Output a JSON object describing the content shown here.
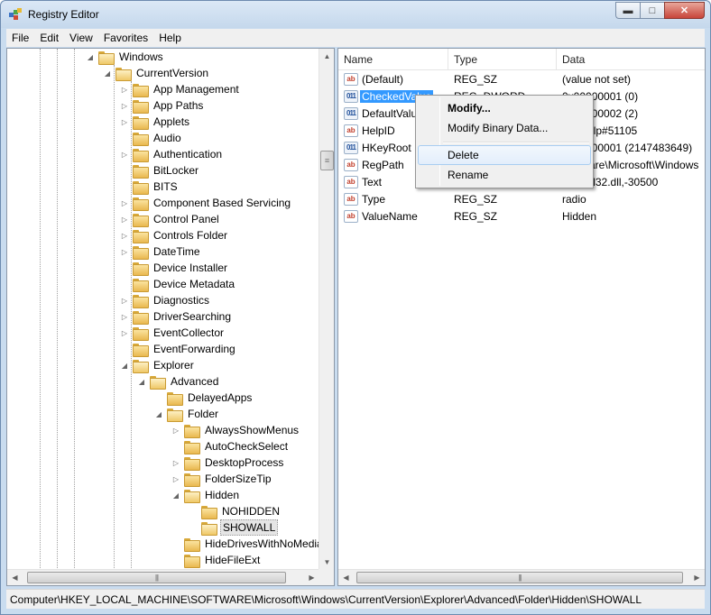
{
  "window": {
    "title": "Registry Editor"
  },
  "menu": [
    "File",
    "Edit",
    "View",
    "Favorites",
    "Help"
  ],
  "tree": [
    {
      "label": "Windows",
      "depth": 0,
      "expander": "open"
    },
    {
      "label": "CurrentVersion",
      "depth": 1,
      "expander": "open"
    },
    {
      "label": "App Management",
      "depth": 2,
      "expander": "closed"
    },
    {
      "label": "App Paths",
      "depth": 2,
      "expander": "closed"
    },
    {
      "label": "Applets",
      "depth": 2,
      "expander": "closed"
    },
    {
      "label": "Audio",
      "depth": 2,
      "expander": "none"
    },
    {
      "label": "Authentication",
      "depth": 2,
      "expander": "closed"
    },
    {
      "label": "BitLocker",
      "depth": 2,
      "expander": "none"
    },
    {
      "label": "BITS",
      "depth": 2,
      "expander": "none"
    },
    {
      "label": "Component Based Servicing",
      "depth": 2,
      "expander": "closed"
    },
    {
      "label": "Control Panel",
      "depth": 2,
      "expander": "closed"
    },
    {
      "label": "Controls Folder",
      "depth": 2,
      "expander": "closed"
    },
    {
      "label": "DateTime",
      "depth": 2,
      "expander": "closed"
    },
    {
      "label": "Device Installer",
      "depth": 2,
      "expander": "none"
    },
    {
      "label": "Device Metadata",
      "depth": 2,
      "expander": "none"
    },
    {
      "label": "Diagnostics",
      "depth": 2,
      "expander": "closed"
    },
    {
      "label": "DriverSearching",
      "depth": 2,
      "expander": "closed"
    },
    {
      "label": "EventCollector",
      "depth": 2,
      "expander": "closed"
    },
    {
      "label": "EventForwarding",
      "depth": 2,
      "expander": "none"
    },
    {
      "label": "Explorer",
      "depth": 2,
      "expander": "open"
    },
    {
      "label": "Advanced",
      "depth": 3,
      "expander": "open"
    },
    {
      "label": "DelayedApps",
      "depth": 4,
      "expander": "none"
    },
    {
      "label": "Folder",
      "depth": 4,
      "expander": "open"
    },
    {
      "label": "AlwaysShowMenus",
      "depth": 5,
      "expander": "closed"
    },
    {
      "label": "AutoCheckSelect",
      "depth": 5,
      "expander": "none"
    },
    {
      "label": "DesktopProcess",
      "depth": 5,
      "expander": "closed"
    },
    {
      "label": "FolderSizeTip",
      "depth": 5,
      "expander": "closed"
    },
    {
      "label": "Hidden",
      "depth": 5,
      "expander": "open"
    },
    {
      "label": "NOHIDDEN",
      "depth": 6,
      "expander": "none"
    },
    {
      "label": "SHOWALL",
      "depth": 6,
      "expander": "none",
      "selected": true
    },
    {
      "label": "HideDrivesWithNoMedia",
      "depth": 5,
      "expander": "none"
    },
    {
      "label": "HideFileExt",
      "depth": 5,
      "expander": "none"
    }
  ],
  "list": {
    "columns": [
      "Name",
      "Type",
      "Data"
    ],
    "rows": [
      {
        "name": "(Default)",
        "type": "REG_SZ",
        "data": "(value not set)",
        "icon": "sz"
      },
      {
        "name": "CheckedValue",
        "type": "REG_DWORD",
        "data": "0x00000001 (0)",
        "icon": "bin",
        "highlight": true
      },
      {
        "name": "DefaultValue",
        "type": "REG_DWORD",
        "data": "0x00000002 (2)",
        "icon": "bin"
      },
      {
        "name": "HelpID",
        "type": "REG_SZ",
        "data": "shell.hlp#51105",
        "icon": "sz"
      },
      {
        "name": "HKeyRoot",
        "type": "REG_DWORD",
        "data": "0x80000001 (2147483649)",
        "icon": "bin"
      },
      {
        "name": "RegPath",
        "type": "REG_SZ",
        "data": "Software\\Microsoft\\Windows",
        "icon": "sz"
      },
      {
        "name": "Text",
        "type": "REG_SZ",
        "data": "@shell32.dll,-30500",
        "icon": "sz"
      },
      {
        "name": "Type",
        "type": "REG_SZ",
        "data": "radio",
        "icon": "sz"
      },
      {
        "name": "ValueName",
        "type": "REG_SZ",
        "data": "Hidden",
        "icon": "sz"
      }
    ]
  },
  "context_menu": {
    "modify": "Modify...",
    "modify_binary": "Modify Binary Data...",
    "delete": "Delete",
    "rename": "Rename"
  },
  "status": {
    "path": "Computer\\HKEY_LOCAL_MACHINE\\SOFTWARE\\Microsoft\\Windows\\CurrentVersion\\Explorer\\Advanced\\Folder\\Hidden\\SHOWALL"
  }
}
